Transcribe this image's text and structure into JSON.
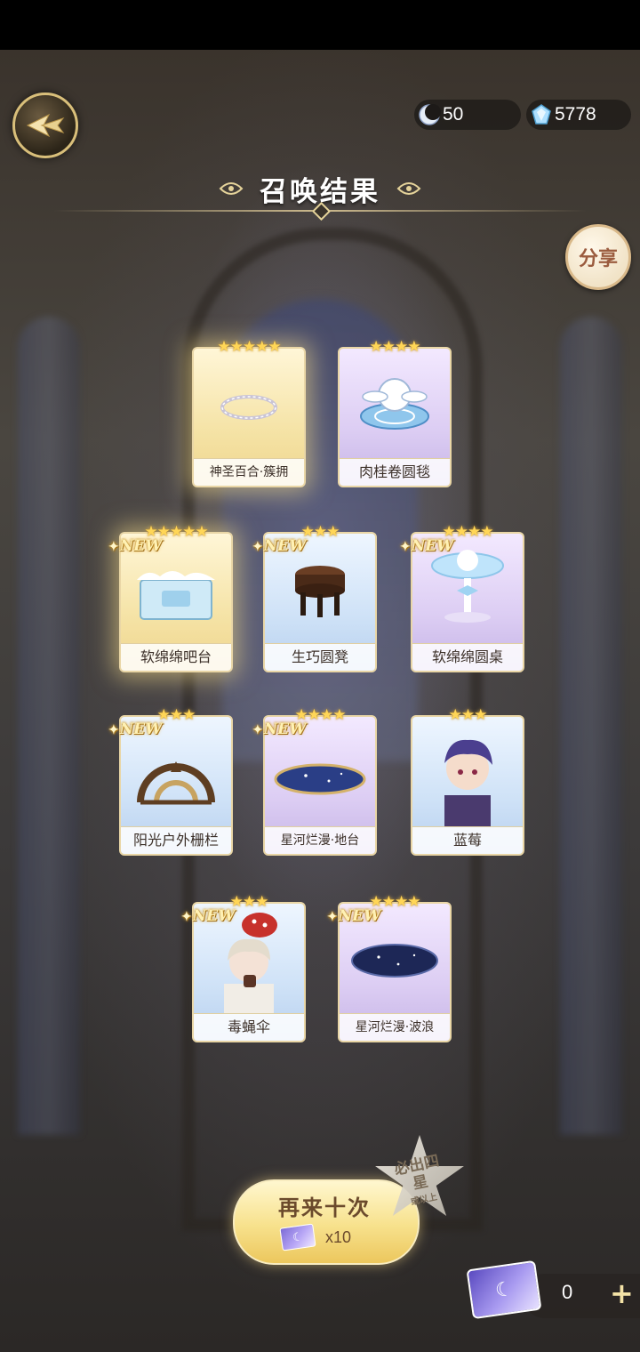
{
  "header": {
    "moon_currency": "50",
    "gem_currency": "5778",
    "title": "召唤结果",
    "share_label": "分享"
  },
  "results": [
    {
      "name": "神圣百合·簇拥",
      "stars": "★★★★★",
      "rarity": 5,
      "is_new": false
    },
    {
      "name": "肉桂卷圆毯",
      "stars": "★★★★",
      "rarity": 4,
      "is_new": false
    },
    {
      "name": "软绵绵吧台",
      "stars": "★★★★★",
      "rarity": 5,
      "is_new": true
    },
    {
      "name": "生巧圆凳",
      "stars": "★★★",
      "rarity": 3,
      "is_new": true
    },
    {
      "name": "软绵绵圆桌",
      "stars": "★★★★",
      "rarity": 4,
      "is_new": true
    },
    {
      "name": "阳光户外栅栏",
      "stars": "★★★",
      "rarity": 3,
      "is_new": true
    },
    {
      "name": "星河烂漫·地台",
      "stars": "★★★★",
      "rarity": 4,
      "is_new": true
    },
    {
      "name": "蓝莓",
      "stars": "★★★",
      "rarity": 3,
      "is_new": false
    },
    {
      "name": "毒蝇伞",
      "stars": "★★★",
      "rarity": 3,
      "is_new": true
    },
    {
      "name": "星河烂漫·波浪",
      "stars": "★★★★",
      "rarity": 4,
      "is_new": true
    }
  ],
  "new_badge_label": "NEW",
  "footer": {
    "again_label": "再来十次",
    "cost": "x10",
    "guarantee_main": "必出四星",
    "guarantee_sub": "或以上",
    "ticket_count": "0",
    "plus_label": "+"
  },
  "colors": {
    "accent_gold": "#e9d6a6",
    "star_gold": "#ffd657",
    "button_text": "#6b4a2c"
  }
}
